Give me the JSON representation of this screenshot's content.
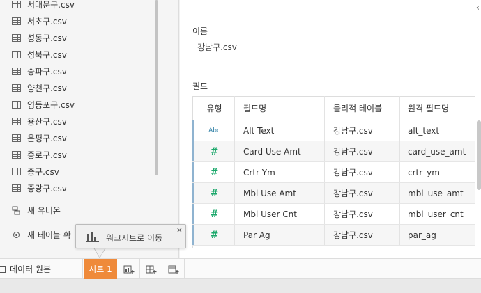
{
  "sidebar": {
    "files": [
      {
        "label": "서대문구.csv"
      },
      {
        "label": "서초구.csv"
      },
      {
        "label": "성동구.csv"
      },
      {
        "label": "성북구.csv"
      },
      {
        "label": "송파구.csv"
      },
      {
        "label": "양천구.csv"
      },
      {
        "label": "영등포구.csv"
      },
      {
        "label": "용산구.csv"
      },
      {
        "label": "은평구.csv"
      },
      {
        "label": "종로구.csv"
      },
      {
        "label": "중구.csv"
      },
      {
        "label": "중랑구.csv"
      }
    ],
    "new_union_label": "새 유니온",
    "new_table_label": "새 테이블 확"
  },
  "details": {
    "name_label": "이름",
    "name_value": "강남구.csv",
    "fields_label": "필드",
    "collapse_glyph": "‹"
  },
  "fields_table": {
    "headers": {
      "type": "유형",
      "field_name": "필드명",
      "physical_table": "물리적 테이블",
      "remote_field_name": "원격 필드명"
    },
    "rows": [
      {
        "type": "Abc",
        "field_name": "Alt Text",
        "physical_table": "강남구.csv",
        "remote_field_name": "alt_text"
      },
      {
        "type": "#",
        "field_name": "Card Use Amt",
        "physical_table": "강남구.csv",
        "remote_field_name": "card_use_amt"
      },
      {
        "type": "#",
        "field_name": "Crtr Ym",
        "physical_table": "강남구.csv",
        "remote_field_name": "crtr_ym"
      },
      {
        "type": "#",
        "field_name": "Mbl Use Amt",
        "physical_table": "강남구.csv",
        "remote_field_name": "mbl_use_amt"
      },
      {
        "type": "#",
        "field_name": "Mbl User Cnt",
        "physical_table": "강남구.csv",
        "remote_field_name": "mbl_user_cnt"
      },
      {
        "type": "#",
        "field_name": "Par Ag",
        "physical_table": "강남구.csv",
        "remote_field_name": "par_ag"
      }
    ]
  },
  "tooltip": {
    "text": "워크시트로 이동",
    "close_glyph": "×",
    "icon": "bar-chart-icon"
  },
  "tabbar": {
    "data_source_label": "데이터 원본",
    "sheet_label": "시트 1",
    "buttons": [
      "new-worksheet-icon",
      "new-dashboard-icon",
      "new-story-icon"
    ]
  },
  "colors": {
    "sheet_tab": "#ef8a3a",
    "number_type": "#1ba86b",
    "string_type": "#2d7fa5",
    "row_marker": "#8fb3d0"
  }
}
